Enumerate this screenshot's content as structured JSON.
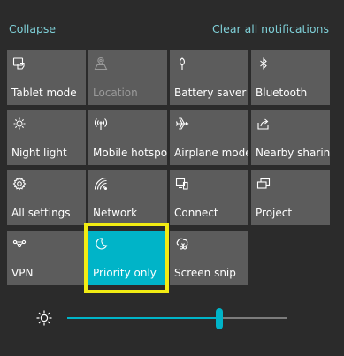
{
  "header": {
    "collapse_label": "Collapse",
    "clear_label": "Clear all notifications"
  },
  "tiles": [
    {
      "label": "Tablet mode",
      "icon": "tablet-mode-icon",
      "state": "off"
    },
    {
      "label": "Location",
      "icon": "location-icon",
      "state": "disabled"
    },
    {
      "label": "Battery saver",
      "icon": "battery-saver-icon",
      "state": "off"
    },
    {
      "label": "Bluetooth",
      "icon": "bluetooth-icon",
      "state": "off"
    },
    {
      "label": "Night light",
      "icon": "night-light-icon",
      "state": "off"
    },
    {
      "label": "Mobile hotspot",
      "icon": "mobile-hotspot-icon",
      "state": "off"
    },
    {
      "label": "Airplane mode",
      "icon": "airplane-icon",
      "state": "off"
    },
    {
      "label": "Nearby sharing",
      "icon": "nearby-sharing-icon",
      "state": "off"
    },
    {
      "label": "All settings",
      "icon": "gear-icon",
      "state": "off"
    },
    {
      "label": "Network",
      "icon": "network-icon",
      "state": "off"
    },
    {
      "label": "Connect",
      "icon": "connect-icon",
      "state": "off"
    },
    {
      "label": "Project",
      "icon": "project-icon",
      "state": "off"
    },
    {
      "label": "VPN",
      "icon": "vpn-icon",
      "state": "off"
    },
    {
      "label": "Priority only",
      "icon": "moon-icon",
      "state": "on"
    },
    {
      "label": "Screen snip",
      "icon": "screen-snip-icon",
      "state": "off"
    }
  ],
  "brightness": {
    "icon": "brightness-icon",
    "value_fraction": 0.69
  },
  "colors": {
    "background": "#2b2b2b",
    "tile": "#5c5c5c",
    "accent": "#00b4c8",
    "link": "#7fd0d8",
    "highlight": "#f2ec13"
  }
}
